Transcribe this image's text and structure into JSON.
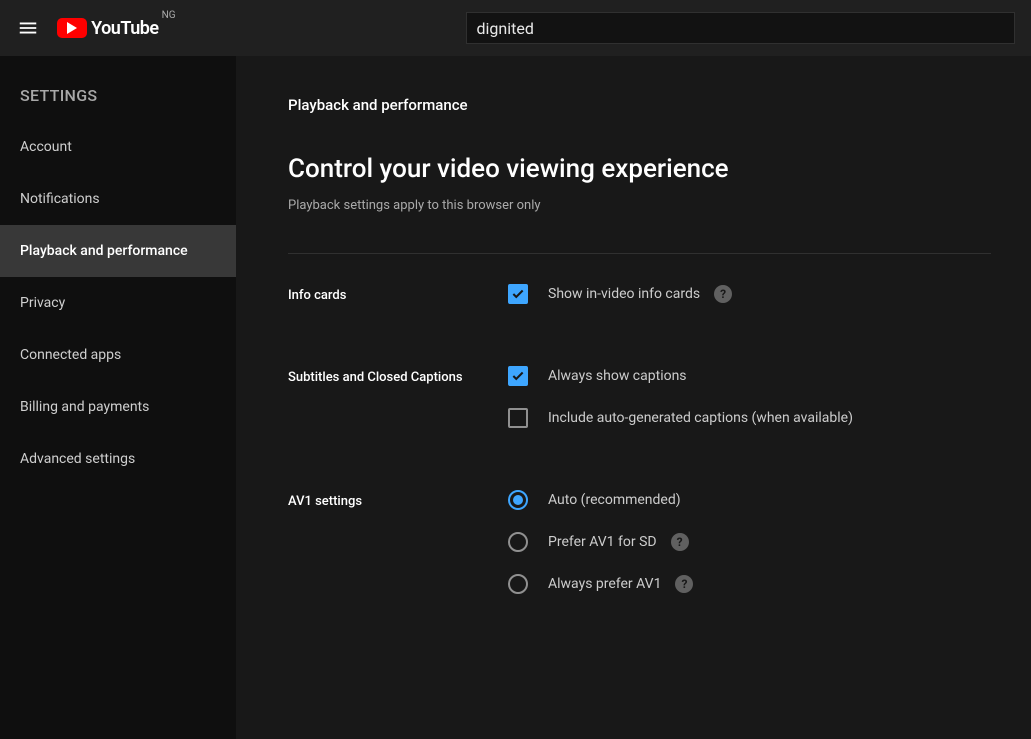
{
  "header": {
    "brand": "YouTube",
    "country_code": "NG",
    "search_value": "dignited"
  },
  "sidebar": {
    "title": "SETTINGS",
    "items": [
      {
        "label": "Account"
      },
      {
        "label": "Notifications"
      },
      {
        "label": "Playback and performance"
      },
      {
        "label": "Privacy"
      },
      {
        "label": "Connected apps"
      },
      {
        "label": "Billing and payments"
      },
      {
        "label": "Advanced settings"
      }
    ]
  },
  "page": {
    "section_label": "Playback and performance",
    "heading": "Control your video viewing experience",
    "subtext": "Playback settings apply to this browser only"
  },
  "settings": {
    "info_cards": {
      "title": "Info cards",
      "opt1": "Show in-video info cards"
    },
    "subtitles": {
      "title": "Subtitles and Closed Captions",
      "opt1": "Always show captions",
      "opt2": "Include auto-generated captions (when available)"
    },
    "av1": {
      "title": "AV1 settings",
      "opt1": "Auto (recommended)",
      "opt2": "Prefer AV1 for SD",
      "opt3": "Always prefer AV1"
    }
  }
}
